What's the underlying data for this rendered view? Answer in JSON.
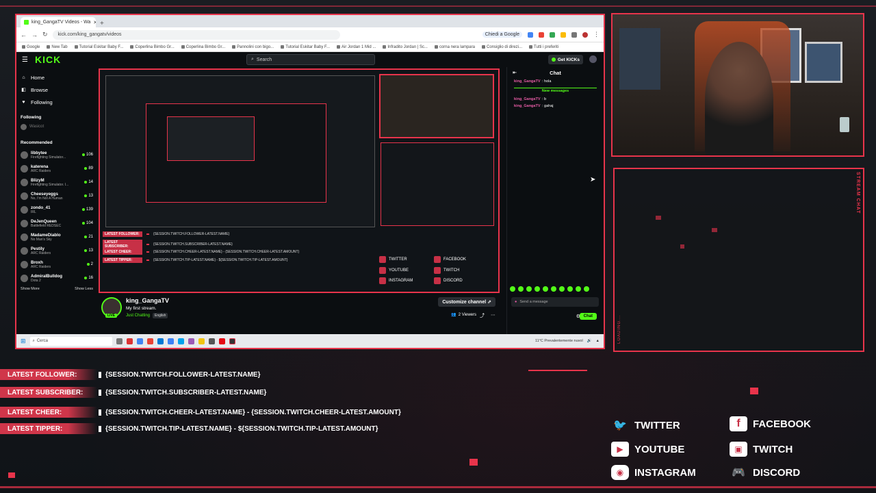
{
  "browser": {
    "tab_title": "king_GangaTV Videos - Wa",
    "url": "kick.com/king_gangatv/videos",
    "translate_chip": "Chiedi a Google",
    "bookmarks": [
      "Google",
      "New Tab",
      "Tutorial Eskitar Baby F...",
      "Coperlina Bimbo Gr...",
      "Coperlina Bimbo Gr...",
      "Pannolini con bigo...",
      "Tutorial Eskitar Baby F...",
      "Air Jordan 1 Mid ...",
      "Infradito Jordan | Sc...",
      "corna nera lampara",
      "Consiglio di direzi...",
      "Tutti i preferiti"
    ]
  },
  "kick": {
    "search_placeholder": "Search",
    "get_kicks": "Get KICKs",
    "nav": [
      "Home",
      "Browse",
      "Following"
    ],
    "following_header": "Following",
    "following_user": "Wasicot",
    "recommended_header": "Recommended",
    "recommended": [
      {
        "name": "libbytee",
        "game": "Firefighting Simulator...",
        "count": "106"
      },
      {
        "name": "katerena",
        "game": "ARC Raiders",
        "count": "89"
      },
      {
        "name": "BlizyM",
        "game": "Firefighting Simulator. I...",
        "count": "14"
      },
      {
        "name": "Cheeseyeggs",
        "game": "No, I'm Not A Human",
        "count": "13"
      },
      {
        "name": "zondo_41",
        "game": "IRL",
        "count": "139"
      },
      {
        "name": "DeJenQueen",
        "game": "Battlefield REDSEC",
        "count": "104"
      },
      {
        "name": "MadameDiablo",
        "game": "No Man's Sky",
        "count": "21"
      },
      {
        "name": "Pestily",
        "game": "ARC Raiders",
        "count": "13"
      },
      {
        "name": "Broxh",
        "game": "ARC Raiders",
        "count": "2"
      },
      {
        "name": "AdmiralBulldog",
        "game": "Dota 2",
        "count": "16"
      }
    ],
    "show_more": "Show More",
    "show_less": "Show Less",
    "channel": {
      "name": "king_GangaTV",
      "title": "My first stream.",
      "category": "Just Chatting",
      "language": "English",
      "live": "LIVE",
      "customize": "Customize channel",
      "viewers": "2 Viewers"
    },
    "chat": {
      "title": "Chat",
      "messages": [
        {
          "user": "king_GangaTV",
          "text": "hola"
        },
        {
          "user": "king_GangaTV",
          "text": "b"
        },
        {
          "user": "king_GangaTV",
          "text": "gahaj"
        }
      ],
      "new_messages": "New messages",
      "input_placeholder": "Send a message",
      "send_label": "Chat"
    }
  },
  "taskbar": {
    "search": "Cerca",
    "weather": "11°C Prevalentemente nuvol"
  },
  "player_mini": {
    "rows": [
      {
        "label": "LATEST FOLLOWER:",
        "value": "{SESSION.TWITCH.FOLLOWER-LATEST.NAME}"
      },
      {
        "label": "LATEST SUBSCRIBER:",
        "value": "{SESSION.TWITCH.SUBSCRIBER-LATEST.NAME}"
      },
      {
        "label": "LATEST CHEER:",
        "value": "{SESSION.TWITCH.CHEER-LATEST.NAME} - {SESSION.TWITCH.CHEER-LATEST.AMOUNT}"
      },
      {
        "label": "LATEST TIPPER:",
        "value": "{SESSION.TWITCH.TIP-LATEST.NAME} - ${SESSION.TWITCH.TIP-LATEST.AMOUNT}"
      }
    ],
    "socials": [
      "TWITTER",
      "YOUTUBE",
      "INSTAGRAM",
      "FACEBOOK",
      "TWITCH",
      "DISCORD"
    ]
  },
  "chatbox": {
    "label": "STREAM CHAT",
    "loading": "LOADING..."
  },
  "overlay": {
    "rows": [
      {
        "label": "LATEST FOLLOWER:",
        "value": "{SESSION.TWITCH.FOLLOWER-LATEST.NAME}"
      },
      {
        "label": "LATEST SUBSCRIBER:",
        "value": "{SESSION.TWITCH.SUBSCRIBER-LATEST.NAME}"
      },
      {
        "label": "LATEST CHEER:",
        "value": "{SESSION.TWITCH.CHEER-LATEST.NAME} - {SESSION.TWITCH.CHEER-LATEST.AMOUNT}"
      },
      {
        "label": "LATEST TIPPER:",
        "value": "{SESSION.TWITCH.TIP-LATEST.NAME} - ${SESSION.TWITCH.TIP-LATEST.AMOUNT}"
      }
    ],
    "socials": {
      "twitter": "TWITTER",
      "youtube": "YOUTUBE",
      "instagram": "INSTAGRAM",
      "facebook": "FACEBOOK",
      "twitch": "TWITCH",
      "discord": "DISCORD"
    }
  },
  "colors": {
    "accent": "#e8344b",
    "kick_green": "#53fc18"
  }
}
